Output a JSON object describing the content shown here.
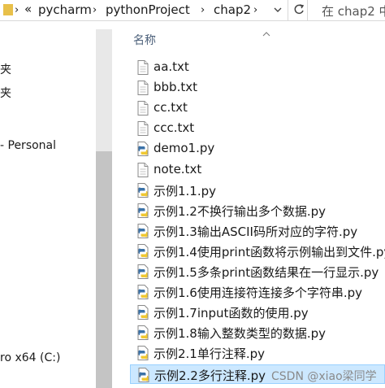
{
  "address": {
    "overflow": "«",
    "crumbs": [
      "pycharm",
      "pythonProject",
      "chap2"
    ],
    "search_placeholder": "在 chap2 中"
  },
  "nav": {
    "items": [
      "夹",
      "夹",
      "- Personal",
      "ro x64 (C:)"
    ]
  },
  "list": {
    "column_header": "名称",
    "files": [
      {
        "name": "aa.txt",
        "type": "text"
      },
      {
        "name": "bbb.txt",
        "type": "text"
      },
      {
        "name": "cc.txt",
        "type": "text"
      },
      {
        "name": "ccc.txt",
        "type": "text"
      },
      {
        "name": "demo1.py",
        "type": "python"
      },
      {
        "name": "note.txt",
        "type": "text"
      },
      {
        "name": "示例1.1.py",
        "type": "python"
      },
      {
        "name": "示例1.2不换行输出多个数据.py",
        "type": "python"
      },
      {
        "name": "示例1.3输出ASCII码所对应的字符.py",
        "type": "python"
      },
      {
        "name": "示例1.4使用print函数将示例输出到文件.py",
        "type": "python"
      },
      {
        "name": "示例1.5多条print函数结果在一行显示.py",
        "type": "python"
      },
      {
        "name": "示例1.6使用连接符连接多个字符串.py",
        "type": "python"
      },
      {
        "name": "示例1.7input函数的使用.py",
        "type": "python"
      },
      {
        "name": "示例1.8输入整数类型的数据.py",
        "type": "python"
      },
      {
        "name": "示例2.1单行注释.py",
        "type": "python"
      },
      {
        "name": "示例2.2多行注释.py",
        "type": "python",
        "selected": true
      }
    ]
  },
  "watermark": "CSDN @xiao梁同学"
}
